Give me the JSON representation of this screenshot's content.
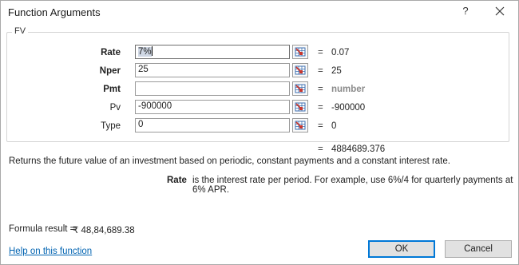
{
  "dialog": {
    "title": "Function Arguments",
    "help_glyph": "?",
    "group_label": "FV"
  },
  "arguments": [
    {
      "name": "Rate",
      "bold": true,
      "input": "7%",
      "value": "0.07"
    },
    {
      "name": "Nper",
      "bold": true,
      "input": "25",
      "value": "25"
    },
    {
      "name": "Pmt",
      "bold": true,
      "input": "",
      "value": "number"
    },
    {
      "name": "Pv",
      "bold": false,
      "input": "-900000",
      "value": "-900000"
    },
    {
      "name": "Type",
      "bold": false,
      "input": "0",
      "value": "0"
    }
  ],
  "equals_sign": "=",
  "result_value": "4884689.376",
  "description": "Returns the future value of an investment based on periodic, constant payments and a constant interest rate.",
  "arg_help": {
    "name": "Rate",
    "text": "is the interest rate per period. For example, use 6%/4 for quarterly payments at 6% APR."
  },
  "formula_result": {
    "label": "Formula result =",
    "value": "₹ 48,84,689.38"
  },
  "help_link": "Help on this function",
  "buttons": {
    "ok": "OK",
    "cancel": "Cancel"
  },
  "icons": {
    "close": "close-icon",
    "collapse": "range-selector-icon"
  },
  "colors": {
    "link": "#0063b1",
    "ok_border": "#0078d7",
    "ref_icon_red": "#c8362e",
    "ref_icon_blue": "#3c6fb0"
  }
}
